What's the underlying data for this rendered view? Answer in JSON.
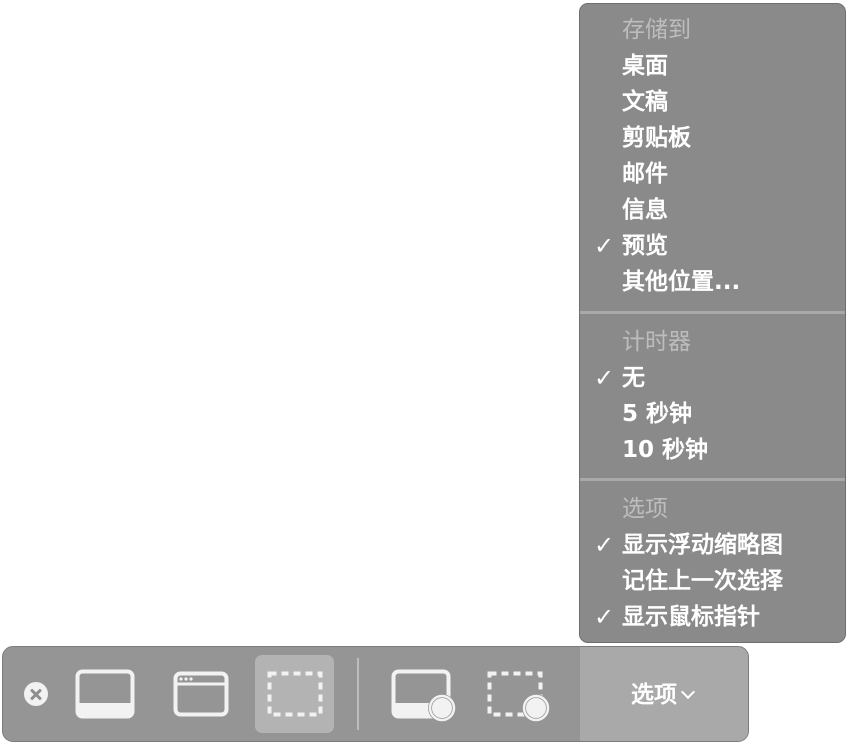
{
  "menu": {
    "save_section": {
      "header": "存储到",
      "items": [
        {
          "label": "桌面",
          "checked": false
        },
        {
          "label": "文稿",
          "checked": false
        },
        {
          "label": "剪贴板",
          "checked": false
        },
        {
          "label": "邮件",
          "checked": false
        },
        {
          "label": "信息",
          "checked": false
        },
        {
          "label": "预览",
          "checked": true
        },
        {
          "label": "其他位置...",
          "checked": false
        }
      ]
    },
    "timer_section": {
      "header": "计时器",
      "items": [
        {
          "label": "无",
          "checked": true
        },
        {
          "label": "5 秒钟",
          "checked": false
        },
        {
          "label": "10 秒钟",
          "checked": false
        }
      ]
    },
    "options_section": {
      "header": "选项",
      "items": [
        {
          "label": "显示浮动缩略图",
          "checked": true
        },
        {
          "label": "记住上一次选择",
          "checked": false
        },
        {
          "label": "显示鼠标指针",
          "checked": true
        }
      ]
    },
    "checkmark": "✓"
  },
  "toolbar": {
    "buttons": [
      {
        "icon": "close-icon"
      },
      {
        "icon": "capture-entire-screen-icon"
      },
      {
        "icon": "capture-window-icon"
      },
      {
        "icon": "capture-selection-icon",
        "selected": true
      },
      {
        "icon": "record-entire-screen-icon"
      },
      {
        "icon": "record-selection-icon"
      }
    ],
    "options_label": "选项"
  },
  "colors": {
    "menu_bg": "#8a8a8a",
    "toolbar_bg": "#959595",
    "selected_bg": "#b3b3b3",
    "text": "#ffffff",
    "header_text": "#bdbdbd"
  }
}
